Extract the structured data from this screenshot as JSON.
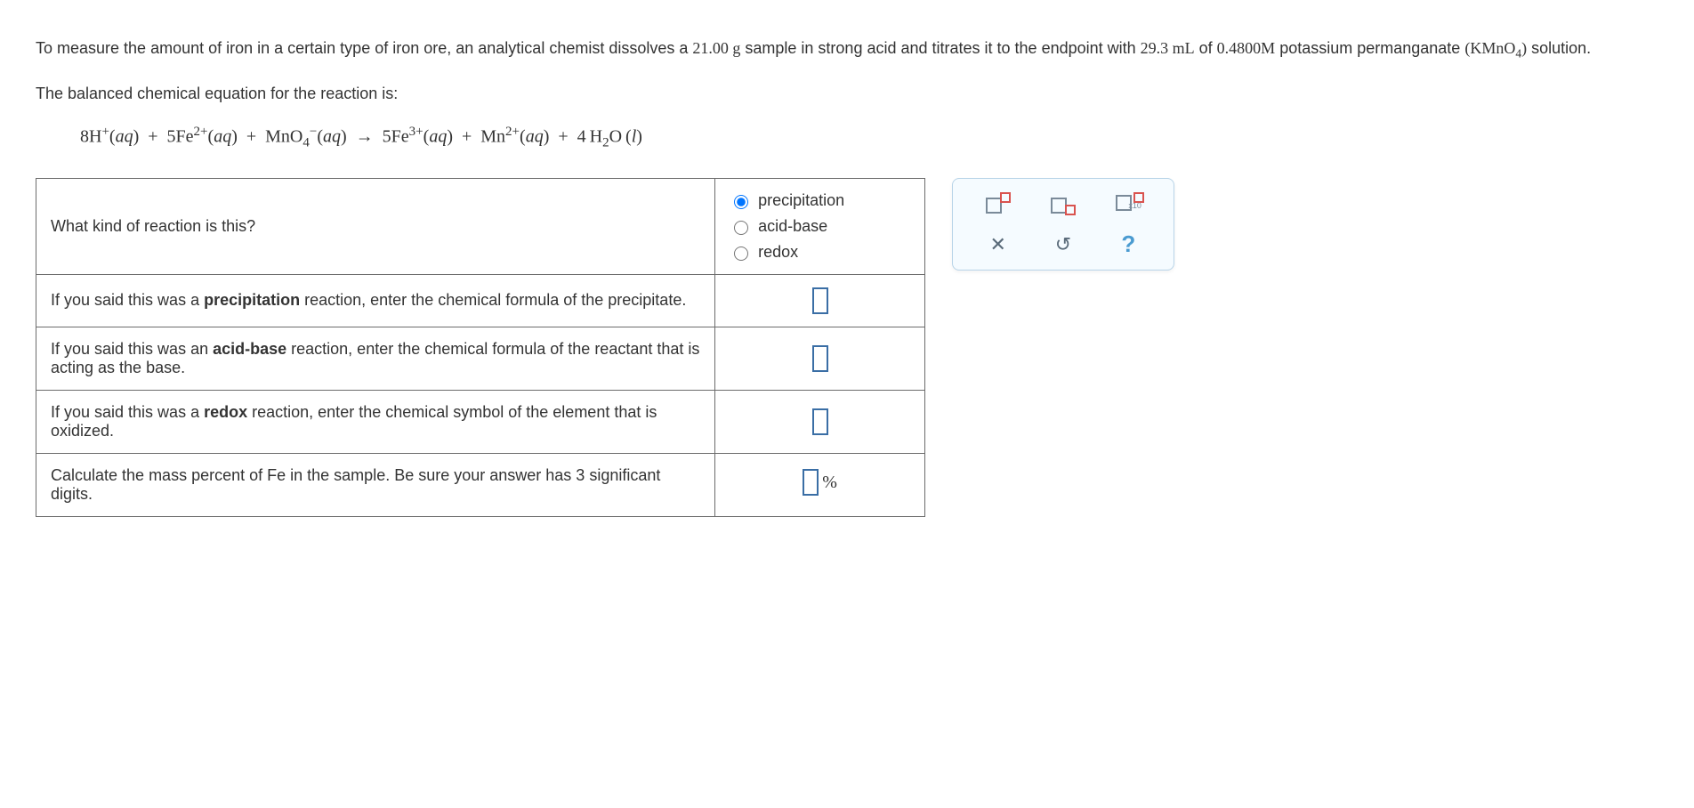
{
  "problem": {
    "part1_pre": "To measure the amount of iron in a certain type of iron ore, an analytical chemist dissolves a ",
    "mass": "21.00 g",
    "part1_mid": " sample in strong acid and titrates it to the endpoint with ",
    "volume": "29.3 mL",
    "part1_of": " of ",
    "molarity": "0.4800M",
    "part1_reagent": " potassium permanganate ",
    "formula": "(KMnO4)",
    "part1_end": " solution.",
    "balanced_label": "The balanced chemical equation for the reaction is:"
  },
  "questions": {
    "q1": "What kind of reaction is this?",
    "q2_a": "If you said this was a ",
    "q2_b": "precipitation",
    "q2_c": " reaction, enter the chemical formula of the precipitate.",
    "q3_a": "If you said this was an ",
    "q3_b": "acid-base",
    "q3_c": " reaction, enter the chemical formula of the reactant that is acting as the base.",
    "q4_a": "If you said this was a ",
    "q4_b": "redox",
    "q4_c": " reaction, enter the chemical symbol of the element that is oxidized.",
    "q5_a": "Calculate the mass percent of ",
    "q5_fe": "Fe",
    "q5_b": " in the sample. Be sure your answer has 3 significant digits."
  },
  "options": {
    "opt1": "precipitation",
    "opt2": "acid-base",
    "opt3": "redox"
  },
  "symbols": {
    "percent": "%",
    "x10": "x10"
  }
}
